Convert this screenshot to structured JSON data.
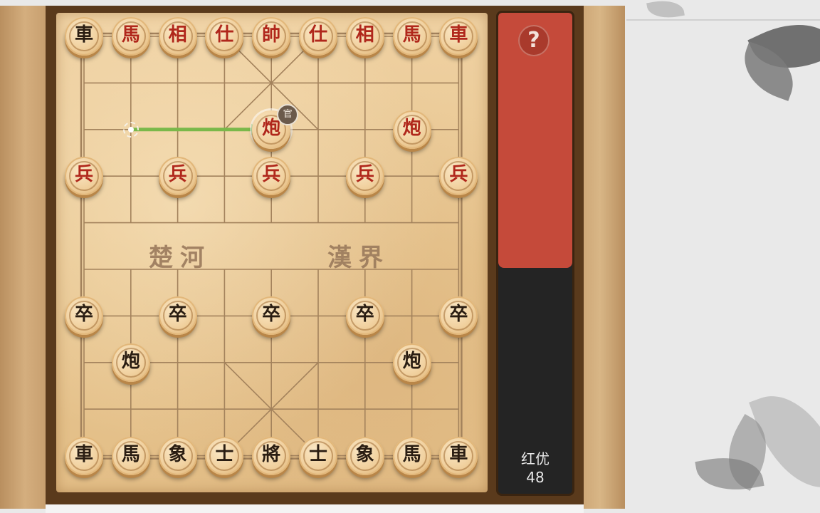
{
  "game": {
    "river_left": "楚河",
    "river_right": "漢界",
    "last_move": {
      "from": "b8",
      "to": "e8"
    },
    "pieces": [
      {
        "id": "r-chariot-1",
        "char": "車",
        "side": "black",
        "file": 0,
        "rank": 0
      },
      {
        "id": "r-horse-1",
        "char": "馬",
        "side": "red",
        "file": 1,
        "rank": 0
      },
      {
        "id": "r-elephant-1",
        "char": "相",
        "side": "red",
        "file": 2,
        "rank": 0
      },
      {
        "id": "r-advisor-1",
        "char": "仕",
        "side": "red",
        "file": 3,
        "rank": 0
      },
      {
        "id": "r-general",
        "char": "帥",
        "side": "red",
        "file": 4,
        "rank": 0
      },
      {
        "id": "r-advisor-2",
        "char": "仕",
        "side": "red",
        "file": 5,
        "rank": 0
      },
      {
        "id": "r-elephant-2",
        "char": "相",
        "side": "red",
        "file": 6,
        "rank": 0
      },
      {
        "id": "r-horse-2",
        "char": "馬",
        "side": "red",
        "file": 7,
        "rank": 0
      },
      {
        "id": "r-chariot-2",
        "char": "車",
        "side": "red",
        "file": 8,
        "rank": 0
      },
      {
        "id": "r-cannon-1",
        "char": "炮",
        "side": "red",
        "file": 4,
        "rank": 2,
        "selected": true,
        "badge": "官"
      },
      {
        "id": "r-cannon-2",
        "char": "炮",
        "side": "red",
        "file": 7,
        "rank": 2
      },
      {
        "id": "r-soldier-1",
        "char": "兵",
        "side": "red",
        "file": 0,
        "rank": 3
      },
      {
        "id": "r-soldier-2",
        "char": "兵",
        "side": "red",
        "file": 2,
        "rank": 3
      },
      {
        "id": "r-soldier-3",
        "char": "兵",
        "side": "red",
        "file": 4,
        "rank": 3
      },
      {
        "id": "r-soldier-4",
        "char": "兵",
        "side": "red",
        "file": 6,
        "rank": 3
      },
      {
        "id": "r-soldier-5",
        "char": "兵",
        "side": "red",
        "file": 8,
        "rank": 3
      },
      {
        "id": "b-pawn-1",
        "char": "卒",
        "side": "black",
        "file": 0,
        "rank": 6
      },
      {
        "id": "b-pawn-2",
        "char": "卒",
        "side": "black",
        "file": 2,
        "rank": 6
      },
      {
        "id": "b-pawn-3",
        "char": "卒",
        "side": "black",
        "file": 4,
        "rank": 6
      },
      {
        "id": "b-pawn-4",
        "char": "卒",
        "side": "black",
        "file": 6,
        "rank": 6
      },
      {
        "id": "b-pawn-5",
        "char": "卒",
        "side": "black",
        "file": 8,
        "rank": 6
      },
      {
        "id": "b-cannon-1",
        "char": "炮",
        "side": "black",
        "file": 1,
        "rank": 7
      },
      {
        "id": "b-cannon-2",
        "char": "炮",
        "side": "black",
        "file": 7,
        "rank": 7
      },
      {
        "id": "b-chariot-1",
        "char": "車",
        "side": "black",
        "file": 0,
        "rank": 9
      },
      {
        "id": "b-horse-1",
        "char": "馬",
        "side": "black",
        "file": 1,
        "rank": 9
      },
      {
        "id": "b-elephant-1",
        "char": "象",
        "side": "black",
        "file": 2,
        "rank": 9
      },
      {
        "id": "b-advisor-1",
        "char": "士",
        "side": "black",
        "file": 3,
        "rank": 9
      },
      {
        "id": "b-general",
        "char": "將",
        "side": "black",
        "file": 4,
        "rank": 9
      },
      {
        "id": "b-advisor-2",
        "char": "士",
        "side": "black",
        "file": 5,
        "rank": 9
      },
      {
        "id": "b-elephant-2",
        "char": "象",
        "side": "black",
        "file": 6,
        "rank": 9
      },
      {
        "id": "b-horse-2",
        "char": "馬",
        "side": "black",
        "file": 7,
        "rank": 9
      },
      {
        "id": "b-chariot-2",
        "char": "車",
        "side": "black",
        "file": 8,
        "rank": 9
      }
    ]
  },
  "panel": {
    "help_label": "?",
    "advantage_label": "红优",
    "advantage_value": "48",
    "advantage_fraction": 0.53,
    "red_color": "#c54a3a",
    "dark_color": "#242424"
  }
}
